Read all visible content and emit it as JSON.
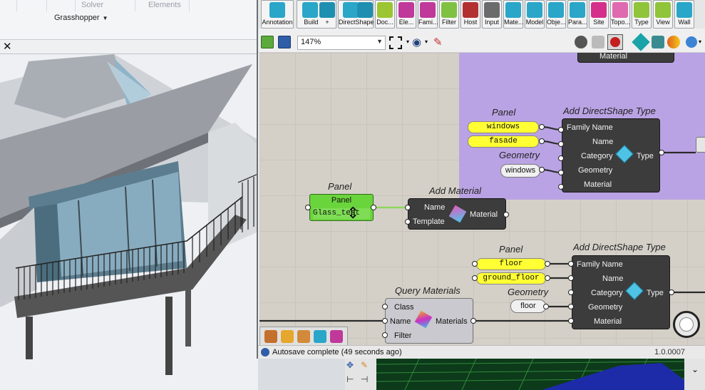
{
  "left_app": {
    "ribbon_groups": [
      "Solver",
      "Elements"
    ],
    "grasshopper_menu": "Grasshopper",
    "close_label": "✕"
  },
  "gh": {
    "tabs": [
      {
        "label": "Annotation",
        "color": "#2aa6c8"
      },
      {
        "label": "Build",
        "color": "#2aa6c8"
      },
      {
        "label": "DirectShape",
        "color": "#2aa6c8"
      },
      {
        "label": "Doc...",
        "color": "#9bc531"
      },
      {
        "label": "Ele...",
        "color": "#c0389a"
      },
      {
        "label": "Fami...",
        "color": "#c0389a"
      },
      {
        "label": "Filter",
        "color": "#7fc241"
      },
      {
        "label": "Host",
        "color": "#b23030"
      },
      {
        "label": "Input",
        "color": "#6b6b6b"
      },
      {
        "label": "Mate...",
        "color": "#2aa6c8"
      },
      {
        "label": "Model",
        "color": "#2aa6c8"
      },
      {
        "label": "Obje...",
        "color": "#2aa6c8"
      },
      {
        "label": "Para...",
        "color": "#2aa6c8"
      },
      {
        "label": "Site",
        "color": "#d42f8a"
      },
      {
        "label": "Topo...",
        "color": "#e06ab0"
      },
      {
        "label": "Type",
        "color": "#8fc43b"
      },
      {
        "label": "View",
        "color": "#8fc43b"
      },
      {
        "label": "Wall",
        "color": "#2aa6c8"
      }
    ],
    "build_plus": "+",
    "zoom_value": "147%",
    "status_text": "Autosave complete (49 seconds ago)",
    "version": "1.0.0007"
  },
  "canvas": {
    "top_node_output": "Material",
    "panel1": {
      "title": "Panel",
      "values": [
        "windows",
        "fasade"
      ]
    },
    "geometry1": {
      "title": "Geometry",
      "value": "windows"
    },
    "add_ds_type1": {
      "title": "Add DirectShape Type",
      "inputs": [
        "Family Name",
        "Name",
        "Category",
        "Geometry",
        "Material"
      ],
      "output": "Type"
    },
    "panel_green": {
      "title": "Panel",
      "header": "Panel",
      "value": "Glass_test"
    },
    "add_material": {
      "title": "Add Material",
      "inputs": [
        "Name",
        "Template"
      ],
      "output": "Material"
    },
    "panel2": {
      "title": "Panel",
      "values": [
        "floor",
        "ground_floor"
      ]
    },
    "geometry2": {
      "title": "Geometry",
      "value": "floor"
    },
    "add_ds_type2": {
      "title": "Add DirectShape Type",
      "inputs": [
        "Family Name",
        "Name",
        "Category",
        "Geometry",
        "Material"
      ],
      "output": "Type"
    },
    "query_materials": {
      "title": "Query Materials",
      "inputs": [
        "Class",
        "Name",
        "Filter"
      ],
      "output": "Materials"
    }
  }
}
